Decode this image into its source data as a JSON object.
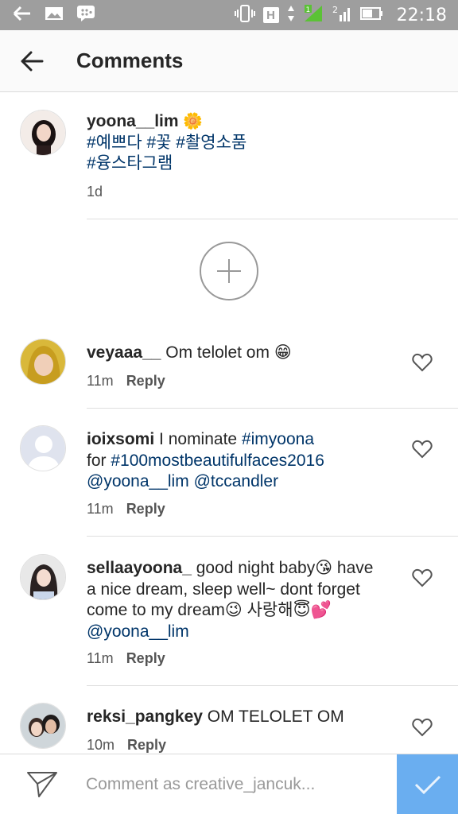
{
  "status_bar": {
    "time": "22:18",
    "network_badge": "H",
    "sim2_label": "2"
  },
  "header": {
    "title": "Comments"
  },
  "caption": {
    "username": "yoona__lim",
    "emoji": "🌼",
    "hashtags_line1": "#예쁘다 #꽃 #촬영소품",
    "hashtags_line2": "#융스타그램",
    "time": "1d"
  },
  "comments": [
    {
      "username": "veyaaa__",
      "text": " Om telolet om 😁",
      "time": "11m",
      "reply_label": "Reply"
    },
    {
      "username": "ioixsomi",
      "text_prefix": " I nominate ",
      "tag1": "#imyoona",
      "text_mid": "for ",
      "tag2": "#100mostbeautifulfaces2016",
      "mention1": "@yoona__lim",
      "mention2": "@tccandler",
      "time": "11m",
      "reply_label": "Reply"
    },
    {
      "username": "sellaayoona_",
      "text_line1": " good night baby😘 have",
      "text_line2": "a nice dream, sleep well~ dont forget",
      "text_line3": "come to my dream😉 사랑해😇💕",
      "mention": "@yoona__lim",
      "time": "11m",
      "reply_label": "Reply"
    },
    {
      "username": "reksi_pangkey",
      "text": " OM TELOLET OM",
      "time": "10m",
      "reply_label": "Reply"
    }
  ],
  "composer": {
    "placeholder": "Comment as creative_jancuk..."
  },
  "colors": {
    "status_bar": "#9e9e9e",
    "link": "#003569",
    "post_button": "#6aaef0"
  }
}
